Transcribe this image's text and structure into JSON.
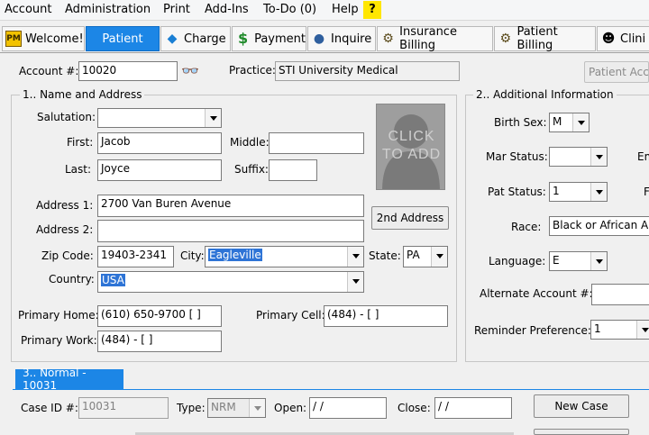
{
  "menu": {
    "items": [
      "Account",
      "Administration",
      "Print",
      "Add-Ins",
      "To-Do (0)",
      "Help"
    ],
    "help_icon": "?"
  },
  "toolbar": {
    "tabs": [
      {
        "label": "Welcome!",
        "icon": "pm-logo-icon",
        "glyph": "PM"
      },
      {
        "label": "Patient",
        "icon": "patient-icon",
        "glyph": ""
      },
      {
        "label": "Charge",
        "icon": "diamond-icon",
        "glyph": "◆"
      },
      {
        "label": "Payment",
        "icon": "dollar-icon",
        "glyph": "$"
      },
      {
        "label": "Inquire",
        "icon": "inquire-icon",
        "glyph": "●"
      },
      {
        "label": "Insurance Billing",
        "icon": "gear-icon",
        "glyph": "⚙"
      },
      {
        "label": "Patient Billing",
        "icon": "gear-icon",
        "glyph": "⚙"
      },
      {
        "label": "Clini",
        "icon": "clinician-icon",
        "glyph": "☻"
      }
    ],
    "active_color": "#1c86e6"
  },
  "account": {
    "label": "Account #:",
    "value": "10020",
    "lookup_icon": "binoculars-icon",
    "practice_label": "Practice:",
    "practice_value": "STI University Medical",
    "patient_access_button": "Patient Acce"
  },
  "name_address": {
    "title": "1.. Name and Address",
    "salutation_label": "Salutation:",
    "salutation_value": "",
    "first_label": "First:",
    "first_value": "Jacob",
    "middle_label": "Middle:",
    "middle_value": "",
    "last_label": "Last:",
    "last_value": "Joyce",
    "suffix_label": "Suffix:",
    "suffix_value": "",
    "photo_text": "CLICK TO ADD",
    "address1_label": "Address 1:",
    "address1_value": "2700 Van Buren Avenue",
    "second_address_button": "2nd Address",
    "address2_label": "Address 2:",
    "address2_value": "",
    "zip_label": "Zip Code:",
    "zip_value": "19403-2341",
    "city_label": "City:",
    "city_value": "Eagleville",
    "state_label": "State:",
    "state_value": "PA",
    "country_label": "Country:",
    "country_value": "USA",
    "primary_home_label": "Primary Home:",
    "primary_home_value": "(610) 650-9700 [    ]",
    "primary_cell_label": "Primary Cell:",
    "primary_cell_value": "(484)    -      [    ]",
    "primary_work_label": "Primary Work:",
    "primary_work_value": "(484)    -      [    ]"
  },
  "additional": {
    "title": "2.. Additional Information",
    "birth_sex_label": "Birth Sex:",
    "birth_sex_value": "M",
    "mar_status_label": "Mar Status:",
    "mar_status_value": "",
    "em_label": "Em",
    "pat_status_label": "Pat Status:",
    "pat_status_value": "1",
    "f_label": "F",
    "race_label": "Race:",
    "race_value": "Black or African Am",
    "language_label": "Language:",
    "language_value": "E",
    "alt_account_label": "Alternate Account #:",
    "alt_account_value": "",
    "reminder_label": "Reminder Preference:",
    "reminder_value": "1"
  },
  "case": {
    "tab_label": "3.. Normal - 10031",
    "case_id_label": "Case ID #:",
    "case_id_value": "10031",
    "type_label": "Type:",
    "type_value": "NRM",
    "open_label": "Open:",
    "open_value": " / /",
    "close_label": "Close:",
    "close_value": " / /",
    "new_case_button": "New Case"
  }
}
